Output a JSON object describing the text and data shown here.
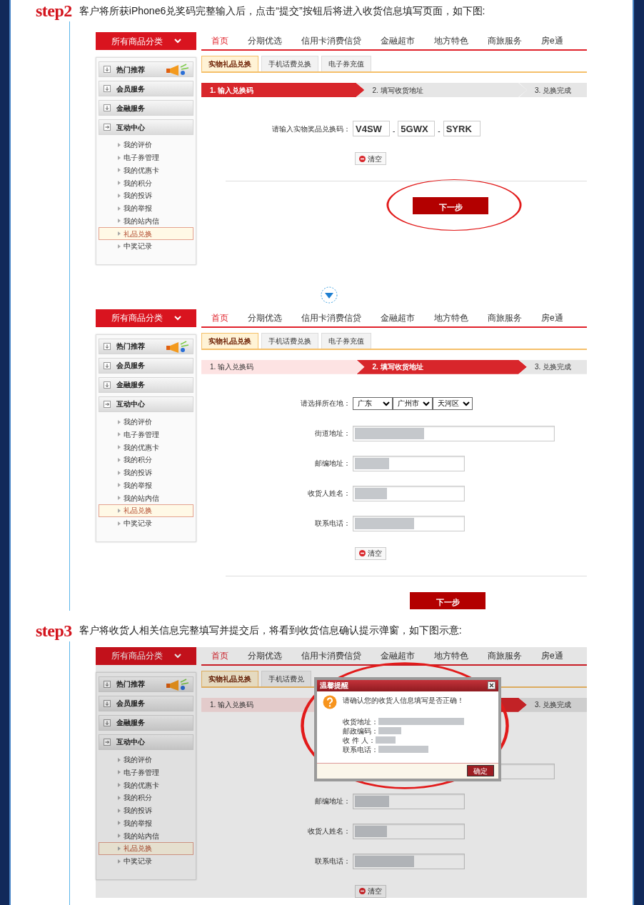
{
  "sections": [
    {
      "badge": "step2",
      "text": "客户将所获iPhone6兑奖码完整输入后，点击“提交”按钮后将进入收货信息填写页面，如下图:",
      "screens": [
        {
          "category": "所有商品分类",
          "nav": [
            {
              "label": "首页",
              "selected": true
            },
            {
              "label": "分期优选",
              "selected": false
            },
            {
              "label": "信用卡消费信贷",
              "selected": false
            },
            {
              "label": "金融超市",
              "selected": false
            },
            {
              "label": "地方特色",
              "selected": false
            },
            {
              "label": "商旅服务",
              "selected": false
            },
            {
              "label": "房e通",
              "selected": false
            }
          ],
          "sidebar": [
            {
              "label": "热门推荐",
              "expanded": false
            },
            {
              "label": "会员服务",
              "expanded": false
            },
            {
              "label": "金融服务",
              "expanded": false
            },
            {
              "label": "互动中心",
              "expanded": true,
              "children": [
                {
                  "label": "我的评价",
                  "selected": false
                },
                {
                  "label": "电子券管理",
                  "selected": false
                },
                {
                  "label": "我的优惠卡",
                  "selected": false
                },
                {
                  "label": "我的积分",
                  "selected": false
                },
                {
                  "label": "我的投诉",
                  "selected": false
                },
                {
                  "label": "我的举报",
                  "selected": false
                },
                {
                  "label": "我的站内信",
                  "selected": false
                },
                {
                  "label": "礼品兑换",
                  "selected": true
                },
                {
                  "label": "中奖记录",
                  "selected": false
                }
              ]
            }
          ],
          "tabs": [
            {
              "label": "实物礼品兑换",
              "selected": true
            },
            {
              "label": "手机话费兑换",
              "selected": false
            },
            {
              "label": "电子券充值",
              "selected": false
            }
          ],
          "steps": [
            {
              "label": "1. 输入兑换码",
              "current": true,
              "done": false
            },
            {
              "label": "2. 填写收货地址",
              "current": false,
              "done": false
            },
            {
              "label": "3. 兑换完成",
              "current": false,
              "done": false
            }
          ],
          "form": {
            "kind": "code",
            "label": "请输入实物奖品兑换码：",
            "parts": [
              "V4SW",
              "5GWX",
              "SYRK"
            ],
            "separators": [
              "-",
              "-"
            ],
            "clear": "清空",
            "next": "下一步",
            "next_circled": true
          }
        },
        {
          "category": "所有商品分类",
          "nav": [
            {
              "label": "首页",
              "selected": true
            },
            {
              "label": "分期优选",
              "selected": false
            },
            {
              "label": "信用卡消费信贷",
              "selected": false
            },
            {
              "label": "金融超市",
              "selected": false
            },
            {
              "label": "地方特色",
              "selected": false
            },
            {
              "label": "商旅服务",
              "selected": false
            },
            {
              "label": "房e通",
              "selected": false
            }
          ],
          "sidebar": [
            {
              "label": "热门推荐",
              "expanded": false
            },
            {
              "label": "会员服务",
              "expanded": false
            },
            {
              "label": "金融服务",
              "expanded": false
            },
            {
              "label": "互动中心",
              "expanded": true,
              "children": [
                {
                  "label": "我的评价",
                  "selected": false
                },
                {
                  "label": "电子券管理",
                  "selected": false
                },
                {
                  "label": "我的优惠卡",
                  "selected": false
                },
                {
                  "label": "我的积分",
                  "selected": false
                },
                {
                  "label": "我的投诉",
                  "selected": false
                },
                {
                  "label": "我的举报",
                  "selected": false
                },
                {
                  "label": "我的站内信",
                  "selected": false
                },
                {
                  "label": "礼品兑换",
                  "selected": true
                },
                {
                  "label": "中奖记录",
                  "selected": false
                }
              ]
            }
          ],
          "tabs": [
            {
              "label": "实物礼品兑换",
              "selected": true
            },
            {
              "label": "手机话费兑换",
              "selected": false
            },
            {
              "label": "电子券充值",
              "selected": false
            }
          ],
          "steps": [
            {
              "label": "1. 输入兑换码",
              "current": false,
              "done": true
            },
            {
              "label": "2. 填写收货地址",
              "current": true,
              "done": false
            },
            {
              "label": "3. 兑换完成",
              "current": false,
              "done": false
            }
          ],
          "form": {
            "kind": "address",
            "region": {
              "label": "请选择所在地：",
              "selects": [
                "广东",
                "广州市",
                "天河区"
              ]
            },
            "fields": [
              {
                "kind": "street",
                "label": "街道地址：",
                "masked": true
              },
              {
                "kind": "zip",
                "label": "邮编地址：",
                "masked": true
              },
              {
                "kind": "name",
                "label": "收货人姓名：",
                "masked": true
              },
              {
                "kind": "phone",
                "label": "联系电话：",
                "masked": true
              }
            ],
            "clear": "清空",
            "next": "下一步"
          }
        }
      ]
    },
    {
      "badge": "step3",
      "text": "客户将收货人相关信息完整填写并提交后，将看到收货信息确认提示弹窗，如下图示意:",
      "screens": [
        {
          "category": "所有商品分类",
          "nav": [
            {
              "label": "首页",
              "selected": true
            },
            {
              "label": "分期优选",
              "selected": false
            },
            {
              "label": "信用卡消费信贷",
              "selected": false
            },
            {
              "label": "金融超市",
              "selected": false
            },
            {
              "label": "地方特色",
              "selected": false
            },
            {
              "label": "商旅服务",
              "selected": false
            },
            {
              "label": "房e通",
              "selected": false
            }
          ],
          "sidebar": [
            {
              "label": "热门推荐",
              "expanded": false
            },
            {
              "label": "会员服务",
              "expanded": false
            },
            {
              "label": "金融服务",
              "expanded": false
            },
            {
              "label": "互动中心",
              "expanded": true,
              "children": [
                {
                  "label": "我的评价",
                  "selected": false
                },
                {
                  "label": "电子券管理",
                  "selected": false
                },
                {
                  "label": "我的优惠卡",
                  "selected": false
                },
                {
                  "label": "我的积分",
                  "selected": false
                },
                {
                  "label": "我的投诉",
                  "selected": false
                },
                {
                  "label": "我的举报",
                  "selected": false
                },
                {
                  "label": "我的站内信",
                  "selected": false
                },
                {
                  "label": "礼品兑换",
                  "selected": true
                },
                {
                  "label": "中奖记录",
                  "selected": false
                }
              ]
            }
          ],
          "tabs": [
            {
              "label": "实物礼品兑换",
              "selected": true
            },
            {
              "label": "手机话费兑",
              "selected": false
            }
          ],
          "steps": [
            {
              "label": "1. 输入兑换码",
              "current": false,
              "done": true
            },
            {
              "current": true,
              "done": false
            },
            {
              "label": "3. 兑换完成",
              "current": false,
              "done": false
            }
          ],
          "form": {
            "kind": "address",
            "fields": [
              {
                "kind": "street"
              },
              {
                "kind": "zip",
                "label": "邮编地址：",
                "masked": true
              },
              {
                "kind": "name",
                "label": "收货人姓名：",
                "masked": true
              },
              {
                "kind": "phone",
                "label": "联系电话：",
                "masked": true
              }
            ],
            "clear": "清空"
          },
          "dialog": {
            "title": "温馨提醒",
            "message": "请确认您的收货人信息填写是否正确！",
            "rows": [
              "收货地址：",
              "邮政编码：",
              "收 件 人：",
              "联系电话："
            ],
            "button": "确定",
            "circled": true
          }
        }
      ]
    }
  ]
}
